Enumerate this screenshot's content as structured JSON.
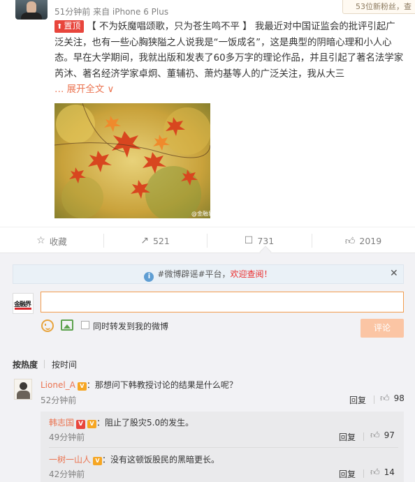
{
  "post": {
    "meta": "51分钟前 来自 iPhone 6 Plus",
    "tip_text": "53位新粉丝，查",
    "pin_label": "置顶",
    "text": "【 不为妖魔唱颂歌，只为苍生鸣不平 】 我最近对中国证监会的批评引起广泛关注，也有一些心胸狭隘之人说我是“一饭成名”，这是典型的阴暗心理和小人心态。早在大学期间，我就出版和发表了60多万字的理论作品，并且引起了著名法学家芮沐、著名经济学家卓炯、董辅礽、萧灼基等人的广泛关注，我从大三",
    "expand_label": "… 展开全文",
    "image_watermark": "@金融界"
  },
  "actions": {
    "favorite": "收藏",
    "forward": "521",
    "comment": "731",
    "like": "2019"
  },
  "comments_panel": {
    "notice_prefix": "#微博辟谣#平台，",
    "notice_link": "欢迎查阅！",
    "sync_label": "同时转发到我的微博",
    "submit_label": "评论",
    "logo_text": "金融界",
    "sort_hot": "按热度",
    "sort_time": "按时间"
  },
  "comments": [
    {
      "user": "Lionel_A",
      "text": "：那想问下韩教授讨论的结果是什么呢？",
      "time": "52分钟前",
      "reply": "回复",
      "likes": "98",
      "replies": [
        {
          "user": "韩志国",
          "text": "：阻止了股灾5.0的发生。",
          "time": "49分钟前",
          "reply": "回复",
          "likes": "97"
        },
        {
          "user": "一树一山人",
          "text": "：没有这顿饭股民的黑暗更长。",
          "time": "42分钟前",
          "reply": "回复",
          "likes": "14"
        }
      ]
    }
  ]
}
